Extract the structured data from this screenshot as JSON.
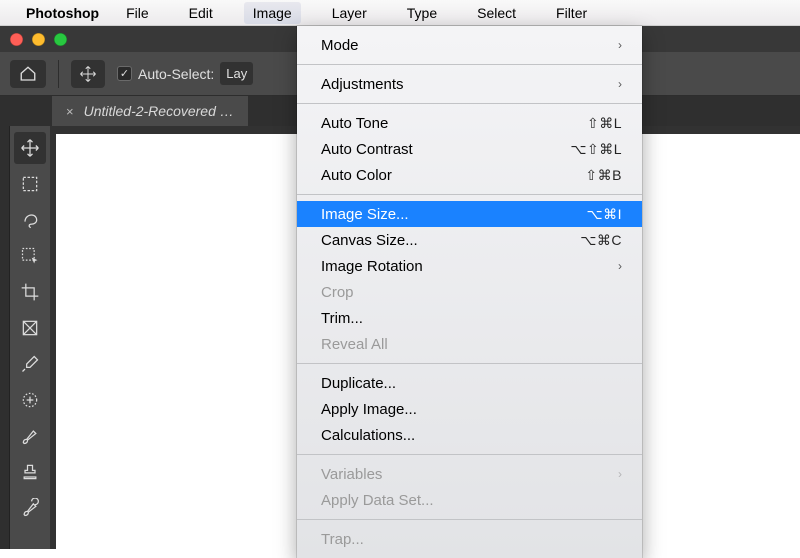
{
  "menubar": {
    "app_name": "Photoshop",
    "items": [
      "File",
      "Edit",
      "Image",
      "Layer",
      "Type",
      "Select",
      "Filter"
    ],
    "open_index": 2
  },
  "options_bar": {
    "auto_select_label": "Auto-Select:",
    "layer_dd": "Lay"
  },
  "document_tab": {
    "close_glyph": "×",
    "title": "Untitled-2-Recovered …"
  },
  "image_menu": [
    {
      "kind": "item",
      "label": "Mode",
      "submenu": true
    },
    {
      "kind": "sep"
    },
    {
      "kind": "item",
      "label": "Adjustments",
      "submenu": true
    },
    {
      "kind": "sep"
    },
    {
      "kind": "item",
      "label": "Auto Tone",
      "shortcut": "⇧⌘L"
    },
    {
      "kind": "item",
      "label": "Auto Contrast",
      "shortcut": "⌥⇧⌘L"
    },
    {
      "kind": "item",
      "label": "Auto Color",
      "shortcut": "⇧⌘B"
    },
    {
      "kind": "sep"
    },
    {
      "kind": "item",
      "label": "Image Size...",
      "shortcut": "⌥⌘I",
      "highlighted": true
    },
    {
      "kind": "item",
      "label": "Canvas Size...",
      "shortcut": "⌥⌘C"
    },
    {
      "kind": "item",
      "label": "Image Rotation",
      "submenu": true
    },
    {
      "kind": "item",
      "label": "Crop",
      "disabled": true
    },
    {
      "kind": "item",
      "label": "Trim..."
    },
    {
      "kind": "item",
      "label": "Reveal All",
      "disabled": true
    },
    {
      "kind": "sep"
    },
    {
      "kind": "item",
      "label": "Duplicate..."
    },
    {
      "kind": "item",
      "label": "Apply Image..."
    },
    {
      "kind": "item",
      "label": "Calculations..."
    },
    {
      "kind": "sep"
    },
    {
      "kind": "item",
      "label": "Variables",
      "submenu": true,
      "disabled": true
    },
    {
      "kind": "item",
      "label": "Apply Data Set...",
      "disabled": true
    },
    {
      "kind": "sep"
    },
    {
      "kind": "item",
      "label": "Trap...",
      "disabled": true
    }
  ],
  "tools": [
    "move",
    "marquee",
    "lasso",
    "quick-select",
    "crop",
    "frame",
    "eyedropper",
    "healing",
    "brush",
    "stamp",
    "history-brush"
  ]
}
